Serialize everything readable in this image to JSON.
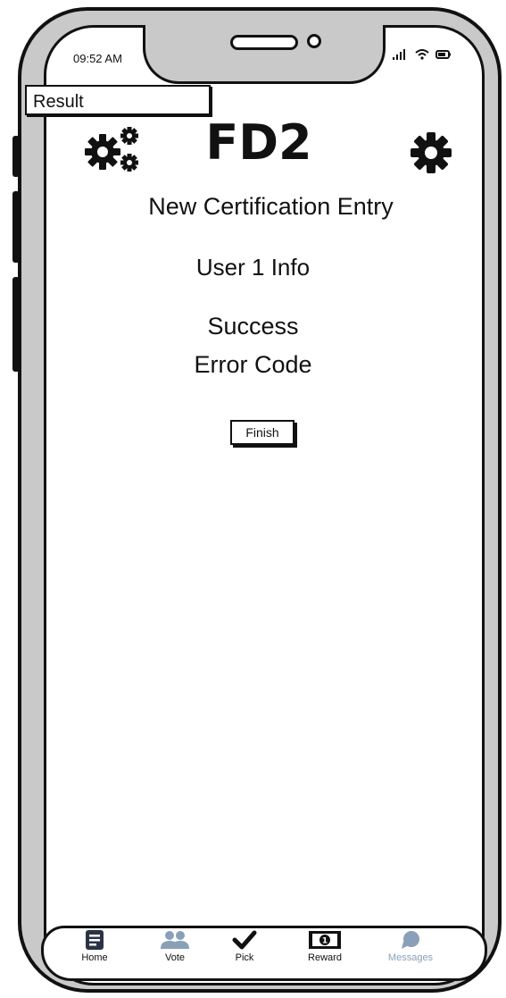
{
  "status_bar": {
    "time": "09:52 AM"
  },
  "screen_tab": "Result",
  "header": {
    "title": "FD2"
  },
  "content": {
    "subtitle": "New Certification Entry",
    "user_info": "User 1 Info",
    "status": "Success",
    "error_code": "Error Code",
    "finish_label": "Finish"
  },
  "tabbar": {
    "items": [
      {
        "label": "Home",
        "icon": "home-icon"
      },
      {
        "label": "Vote",
        "icon": "users-icon"
      },
      {
        "label": "Pick",
        "icon": "check-icon"
      },
      {
        "label": "Reward",
        "icon": "reward-icon"
      },
      {
        "label": "Messages",
        "icon": "chat-icon"
      }
    ]
  },
  "colors": {
    "frame": "#c9c9c9",
    "outline": "#111111",
    "inactive": "#8aa0b8"
  }
}
